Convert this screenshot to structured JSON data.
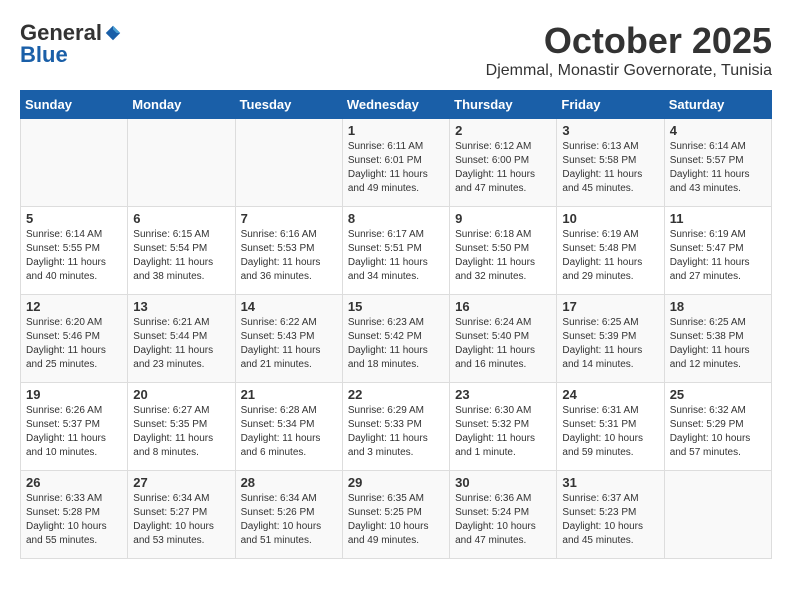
{
  "logo": {
    "general": "General",
    "blue": "Blue"
  },
  "header": {
    "month": "October 2025",
    "location": "Djemmal, Monastir Governorate, Tunisia"
  },
  "weekdays": [
    "Sunday",
    "Monday",
    "Tuesday",
    "Wednesday",
    "Thursday",
    "Friday",
    "Saturday"
  ],
  "weeks": [
    [
      {
        "day": "",
        "info": ""
      },
      {
        "day": "",
        "info": ""
      },
      {
        "day": "",
        "info": ""
      },
      {
        "day": "1",
        "info": "Sunrise: 6:11 AM\nSunset: 6:01 PM\nDaylight: 11 hours\nand 49 minutes."
      },
      {
        "day": "2",
        "info": "Sunrise: 6:12 AM\nSunset: 6:00 PM\nDaylight: 11 hours\nand 47 minutes."
      },
      {
        "day": "3",
        "info": "Sunrise: 6:13 AM\nSunset: 5:58 PM\nDaylight: 11 hours\nand 45 minutes."
      },
      {
        "day": "4",
        "info": "Sunrise: 6:14 AM\nSunset: 5:57 PM\nDaylight: 11 hours\nand 43 minutes."
      }
    ],
    [
      {
        "day": "5",
        "info": "Sunrise: 6:14 AM\nSunset: 5:55 PM\nDaylight: 11 hours\nand 40 minutes."
      },
      {
        "day": "6",
        "info": "Sunrise: 6:15 AM\nSunset: 5:54 PM\nDaylight: 11 hours\nand 38 minutes."
      },
      {
        "day": "7",
        "info": "Sunrise: 6:16 AM\nSunset: 5:53 PM\nDaylight: 11 hours\nand 36 minutes."
      },
      {
        "day": "8",
        "info": "Sunrise: 6:17 AM\nSunset: 5:51 PM\nDaylight: 11 hours\nand 34 minutes."
      },
      {
        "day": "9",
        "info": "Sunrise: 6:18 AM\nSunset: 5:50 PM\nDaylight: 11 hours\nand 32 minutes."
      },
      {
        "day": "10",
        "info": "Sunrise: 6:19 AM\nSunset: 5:48 PM\nDaylight: 11 hours\nand 29 minutes."
      },
      {
        "day": "11",
        "info": "Sunrise: 6:19 AM\nSunset: 5:47 PM\nDaylight: 11 hours\nand 27 minutes."
      }
    ],
    [
      {
        "day": "12",
        "info": "Sunrise: 6:20 AM\nSunset: 5:46 PM\nDaylight: 11 hours\nand 25 minutes."
      },
      {
        "day": "13",
        "info": "Sunrise: 6:21 AM\nSunset: 5:44 PM\nDaylight: 11 hours\nand 23 minutes."
      },
      {
        "day": "14",
        "info": "Sunrise: 6:22 AM\nSunset: 5:43 PM\nDaylight: 11 hours\nand 21 minutes."
      },
      {
        "day": "15",
        "info": "Sunrise: 6:23 AM\nSunset: 5:42 PM\nDaylight: 11 hours\nand 18 minutes."
      },
      {
        "day": "16",
        "info": "Sunrise: 6:24 AM\nSunset: 5:40 PM\nDaylight: 11 hours\nand 16 minutes."
      },
      {
        "day": "17",
        "info": "Sunrise: 6:25 AM\nSunset: 5:39 PM\nDaylight: 11 hours\nand 14 minutes."
      },
      {
        "day": "18",
        "info": "Sunrise: 6:25 AM\nSunset: 5:38 PM\nDaylight: 11 hours\nand 12 minutes."
      }
    ],
    [
      {
        "day": "19",
        "info": "Sunrise: 6:26 AM\nSunset: 5:37 PM\nDaylight: 11 hours\nand 10 minutes."
      },
      {
        "day": "20",
        "info": "Sunrise: 6:27 AM\nSunset: 5:35 PM\nDaylight: 11 hours\nand 8 minutes."
      },
      {
        "day": "21",
        "info": "Sunrise: 6:28 AM\nSunset: 5:34 PM\nDaylight: 11 hours\nand 6 minutes."
      },
      {
        "day": "22",
        "info": "Sunrise: 6:29 AM\nSunset: 5:33 PM\nDaylight: 11 hours\nand 3 minutes."
      },
      {
        "day": "23",
        "info": "Sunrise: 6:30 AM\nSunset: 5:32 PM\nDaylight: 11 hours\nand 1 minute."
      },
      {
        "day": "24",
        "info": "Sunrise: 6:31 AM\nSunset: 5:31 PM\nDaylight: 10 hours\nand 59 minutes."
      },
      {
        "day": "25",
        "info": "Sunrise: 6:32 AM\nSunset: 5:29 PM\nDaylight: 10 hours\nand 57 minutes."
      }
    ],
    [
      {
        "day": "26",
        "info": "Sunrise: 6:33 AM\nSunset: 5:28 PM\nDaylight: 10 hours\nand 55 minutes."
      },
      {
        "day": "27",
        "info": "Sunrise: 6:34 AM\nSunset: 5:27 PM\nDaylight: 10 hours\nand 53 minutes."
      },
      {
        "day": "28",
        "info": "Sunrise: 6:34 AM\nSunset: 5:26 PM\nDaylight: 10 hours\nand 51 minutes."
      },
      {
        "day": "29",
        "info": "Sunrise: 6:35 AM\nSunset: 5:25 PM\nDaylight: 10 hours\nand 49 minutes."
      },
      {
        "day": "30",
        "info": "Sunrise: 6:36 AM\nSunset: 5:24 PM\nDaylight: 10 hours\nand 47 minutes."
      },
      {
        "day": "31",
        "info": "Sunrise: 6:37 AM\nSunset: 5:23 PM\nDaylight: 10 hours\nand 45 minutes."
      },
      {
        "day": "",
        "info": ""
      }
    ]
  ]
}
